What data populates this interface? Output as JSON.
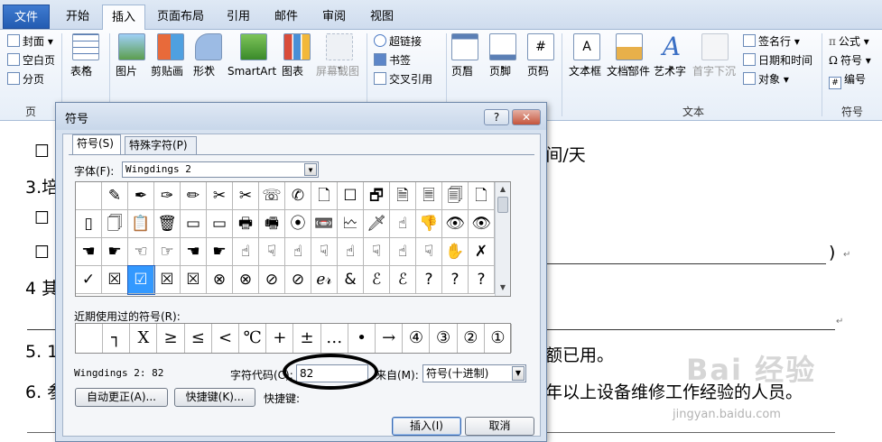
{
  "ribbon": {
    "tabs": [
      "文件",
      "开始",
      "插入",
      "页面布局",
      "引用",
      "邮件",
      "审阅",
      "视图"
    ],
    "active_tab": "插入",
    "pages_group": {
      "items": [
        "封面",
        "空白页",
        "分页"
      ],
      "label": "页"
    },
    "table_btn": "表格",
    "illus": {
      "picture": "图片",
      "clipart": "剪贴画",
      "shapes": "形状",
      "smartart": "SmartArt",
      "chart": "图表",
      "screenshot": "屏幕截图"
    },
    "links": {
      "hyperlink": "超链接",
      "bookmark": "书签",
      "crossref": "交叉引用"
    },
    "header_footer": {
      "header": "页眉",
      "footer": "页脚",
      "pagenum": "页码"
    },
    "text_group": {
      "textbox": "文本框",
      "quickparts": "文档部件",
      "wordart": "艺术字",
      "dropcap": "首字下沉",
      "signature": "签名行",
      "datetime": "日期和时间",
      "object": "对象",
      "label": "文本"
    },
    "symbols_group": {
      "equation": "公式",
      "symbol": "符号",
      "number": "编号",
      "label": "符号"
    }
  },
  "document": {
    "lines": [
      "☐",
      "/间/天",
      "3.培",
      "☐",
      "☐",
      ")",
      "4 其",
      "5. 1",
      "额已用。",
      "6. 参",
      "年以上设备维修工作经验的人员。"
    ]
  },
  "dialog": {
    "title": "符号",
    "help": "?",
    "close": "✕",
    "tabs": [
      "符号(S)",
      "特殊字符(P)"
    ],
    "font_label": "字体(F):",
    "font_value": "Wingdings 2",
    "symbols": [
      "",
      "✎",
      "✒",
      "✑",
      "✏",
      "✂",
      "✂",
      "☏",
      "✆",
      "🗋",
      "☐",
      "🗗",
      "🗎",
      "🗏",
      "🗐",
      "🗋",
      "▯",
      "🗍",
      "📋",
      "🗑",
      "▭",
      "▭",
      "🖶",
      "🖷",
      "⦿",
      "📼",
      "🗠",
      "🗡",
      "☝",
      "👎",
      "👁",
      "👁",
      "☚",
      "☛",
      "☜",
      "☞",
      "☚",
      "☛",
      "☝",
      "☟",
      "☝",
      "☟",
      "☝",
      "☟",
      "☝",
      "☟",
      "✋",
      "✗",
      "✓",
      "☒",
      "☑",
      "☒",
      "☒",
      "⊗",
      "⊗",
      "⊘",
      "⊘",
      "ℯ𝓇",
      "&",
      "ℰ",
      "ℰ",
      "?",
      "?",
      "?"
    ],
    "selected_index": 50,
    "recent_label": "近期使用过的符号(R):",
    "recent": [
      "",
      "┐",
      "X",
      "≥",
      "≤",
      "<",
      "℃",
      "+",
      "±",
      "…",
      "•",
      "→",
      "④",
      "③",
      "②",
      "①"
    ],
    "symbol_name": "Wingdings 2: 82",
    "code_label": "字符代码(C):",
    "code_value": "82",
    "from_label": "来自(M):",
    "from_value": "符号(十进制)",
    "autocorrect": "自动更正(A)...",
    "shortcut_btn": "快捷键(K)...",
    "shortcut_label": "快捷键:",
    "insert": "插入(I)",
    "cancel": "取消"
  },
  "watermark": {
    "main": "Bai 经验",
    "url": "jingyan.baidu.com"
  }
}
